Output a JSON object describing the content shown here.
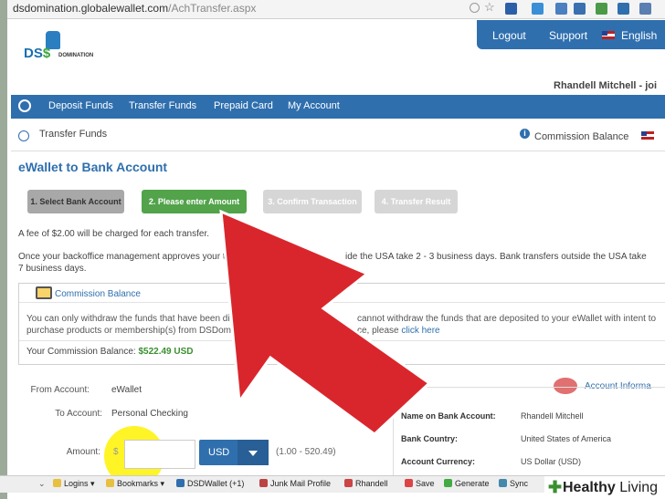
{
  "browser": {
    "url_host": "dsdomination.globalewallet.com",
    "url_path": "/AchTransfer.aspx"
  },
  "header": {
    "logo_text": "DS",
    "logo_dollar": "$",
    "logo_sub": "DOMINATION",
    "nav": [
      "Logout",
      "Support",
      "English"
    ],
    "username": "Rhandell Mitchell - joi"
  },
  "mainnav": {
    "items": [
      "Deposit Funds",
      "Transfer Funds",
      "Prepaid Card",
      "My Account"
    ]
  },
  "subhead": {
    "title": "Transfer Funds",
    "commission_balance": "Commission Balance"
  },
  "page": {
    "title": "eWallet to Bank Account",
    "steps": [
      "1. Select Bank Account",
      "2. Please enter Amount",
      "3. Confirm Transaction",
      "4. Transfer Result"
    ],
    "fee_text": "A fee of  $2.00  will be charged for each transfer.",
    "approval_left": "Once your backoffice management approves your tra",
    "approval_right": "ide the USA take 2 - 3 business days. Bank transfers outside the USA take",
    "approval_line2": "7 business days."
  },
  "commission_box": {
    "title": "Commission Balance",
    "body_l1a": "You can only withdraw the funds that have been disbursed/p",
    "body_l1b": "cannot withdraw the funds that are deposited to your eWallet with intent to",
    "body_l2a": "purchase products or membership(s) from DSDomination. T",
    "body_l2b": "ce, please",
    "link": "click here",
    "balance_label": "Your Commission Balance:",
    "balance_value": "$522.49 USD"
  },
  "form": {
    "from_label": "From Account:",
    "from_value": "eWallet",
    "to_label": "To Account:",
    "to_value": "Personal Checking",
    "amount_label": "Amount:",
    "amount_prefix": "$",
    "amount_value": "",
    "currency": "USD",
    "range": "(1.00 - 520.49)"
  },
  "account_info": {
    "title": "Account Informa",
    "rows": [
      {
        "label": "Name on Bank Account:",
        "value": "Rhandell Mitchell"
      },
      {
        "label": "Bank Country:",
        "value": "United States of America"
      },
      {
        "label": "Account Currency:",
        "value": "US Dollar (USD)"
      }
    ]
  },
  "bookmarks": [
    "Logins",
    "Bookmarks",
    "DSDWallet (+1)",
    "Junk Mail Profile",
    "Rhandell",
    "Save",
    "Generate",
    "Sync"
  ],
  "watermark": {
    "word_bold": "Healthy",
    "word_light": "Living"
  },
  "colors": {
    "nav_blue": "#2f6fae",
    "step_active": "#52a34a",
    "arrow_red": "#d9262c"
  }
}
